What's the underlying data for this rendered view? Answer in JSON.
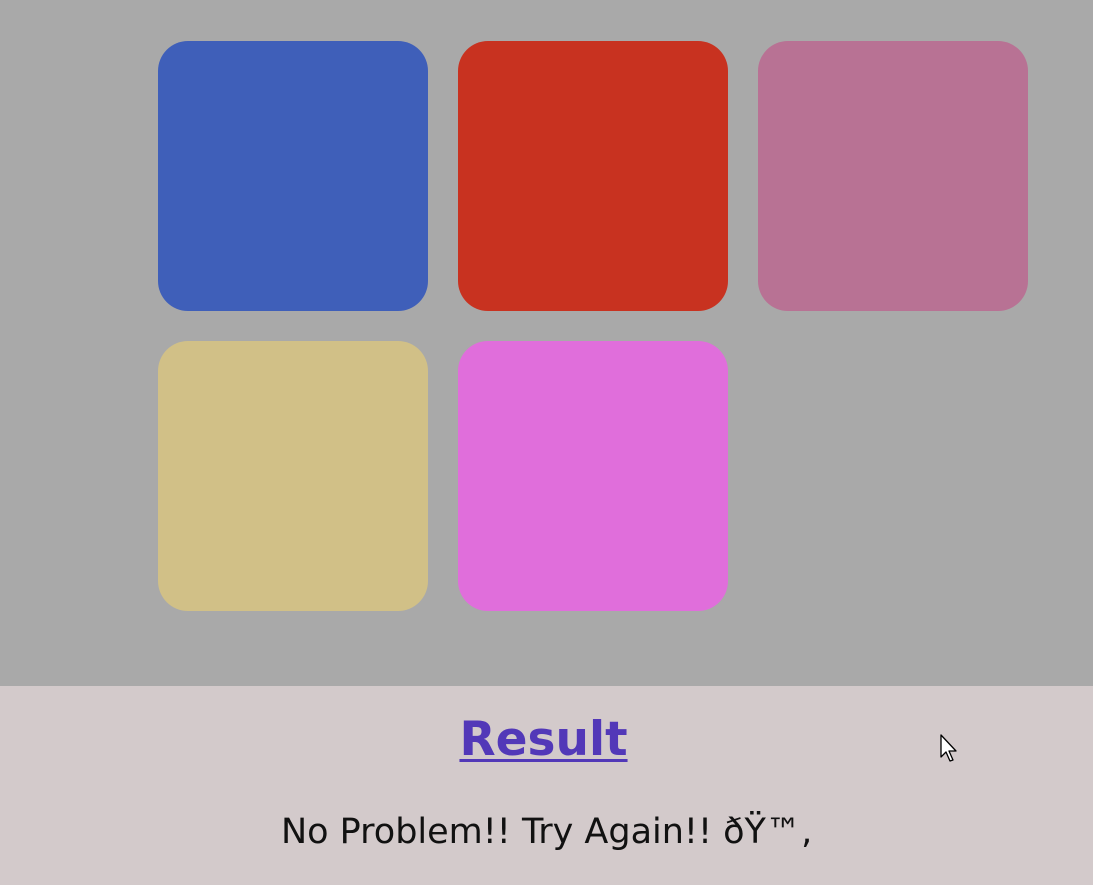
{
  "tiles": [
    {
      "id": "tile-1",
      "color": "#3f5fb9"
    },
    {
      "id": "tile-2",
      "color": "#c83220"
    },
    {
      "id": "tile-3",
      "color": "#b87294"
    },
    {
      "id": "tile-4",
      "color": "#d1c087"
    },
    {
      "id": "tile-5",
      "color": "#e06edb"
    }
  ],
  "result": {
    "title": "Result",
    "message": "No Problem!! Try Again!! ðŸ™‚"
  },
  "cursor": {
    "icon": "mouse-pointer-icon"
  }
}
